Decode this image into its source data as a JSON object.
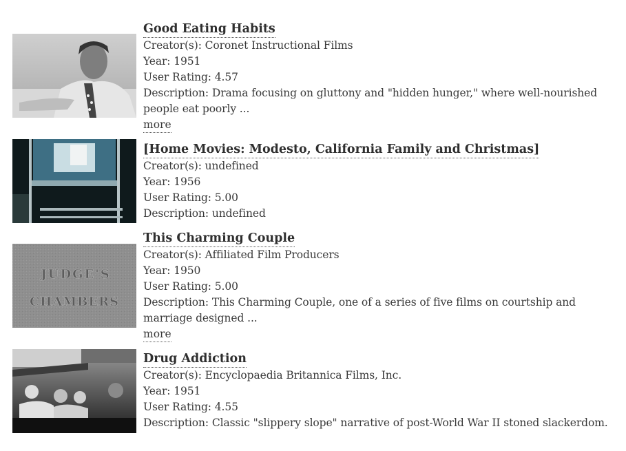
{
  "results": [
    {
      "title": "Good Eating Habits",
      "creator": "Creator(s): Coronet Instructional Films",
      "year": "Year: 1951",
      "rating": "User Rating: 4.57",
      "description": "Description: Drama focusing on gluttony and \"hidden hunger,\" where well-nourished people eat poorly ...",
      "more_label": "more"
    },
    {
      "title": "[Home Movies: Modesto, California Family and Christmas]",
      "creator": "Creator(s): undefined",
      "year": "Year: 1956",
      "rating": "User Rating: 5.00",
      "description": "Description: undefined"
    },
    {
      "title": "This Charming Couple",
      "creator": "Creator(s): Affiliated Film Producers",
      "year": "Year: 1950",
      "rating": "User Rating: 5.00",
      "description": "Description: This Charming Couple, one of a series of five films on courtship and marriage designed ...",
      "more_label": "more",
      "thumb_text": [
        "JUDGE'S",
        "CHAMBERS"
      ]
    },
    {
      "title": "Drug Addiction",
      "creator": "Creator(s): Encyclopaedia Britannica Films, Inc.",
      "year": "Year: 1951",
      "rating": "User Rating: 4.55",
      "description": "Description: Classic \"slippery slope\" narrative of post-World War II stoned slackerdom."
    }
  ]
}
